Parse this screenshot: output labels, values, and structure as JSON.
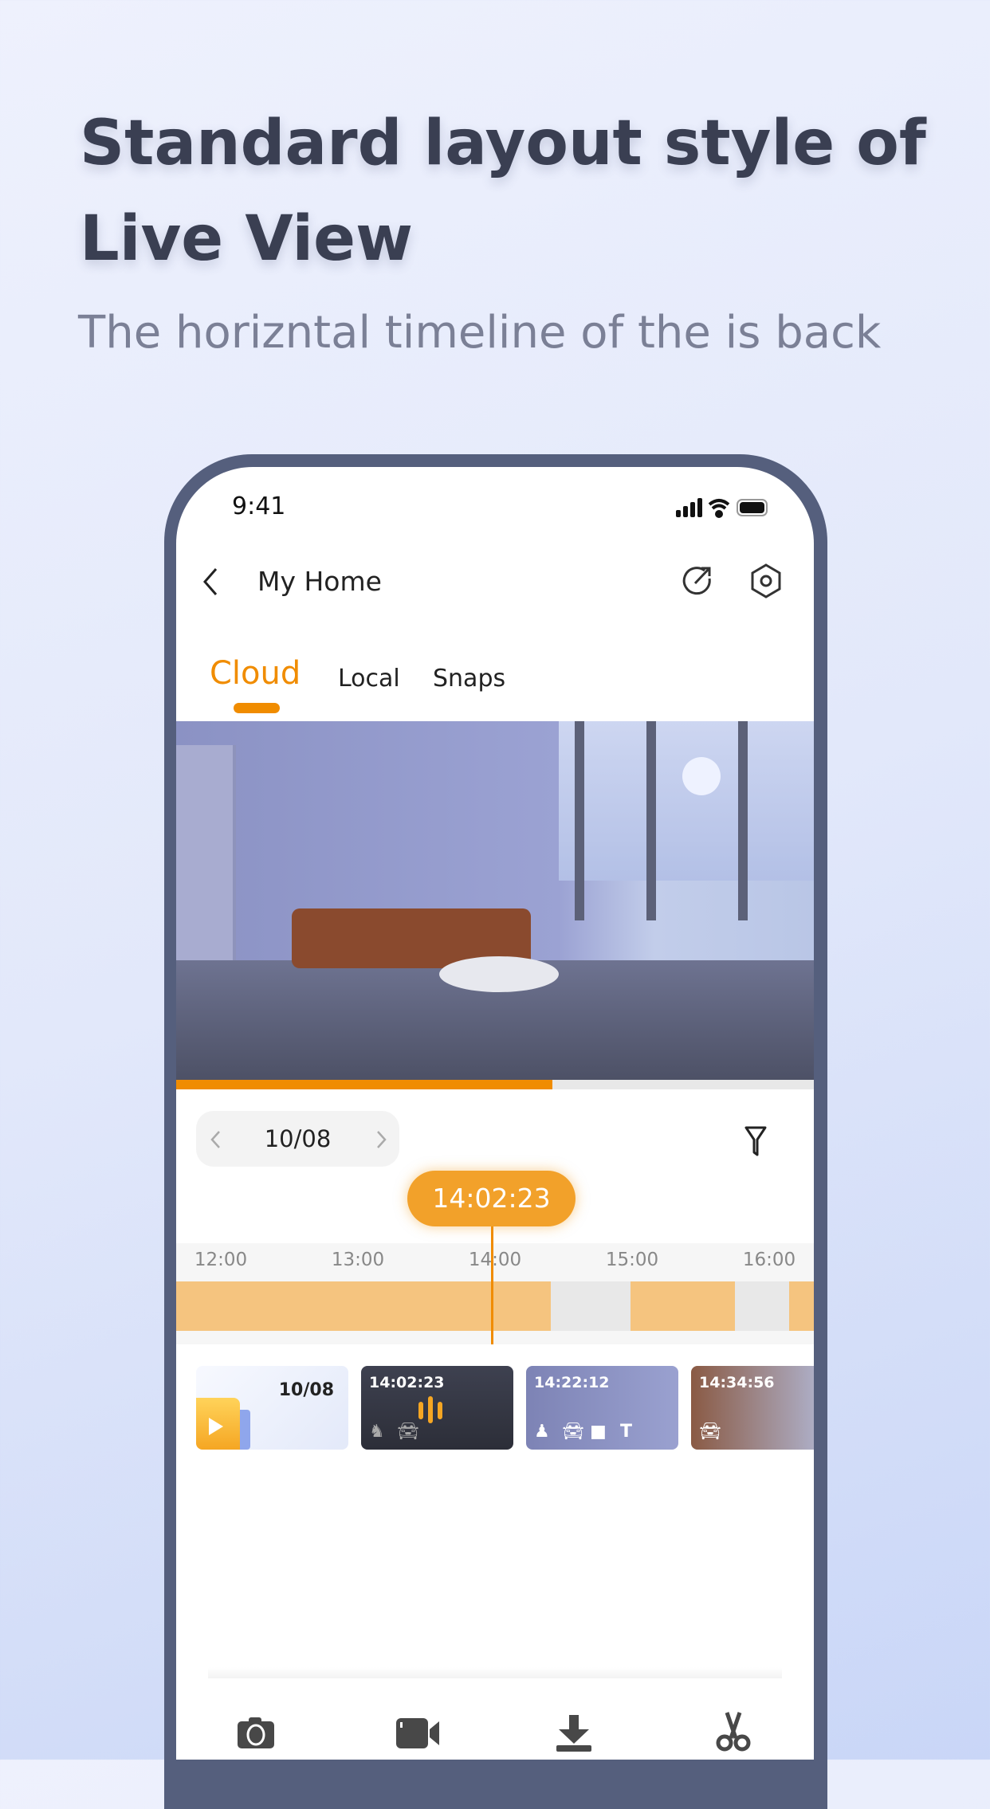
{
  "promo": {
    "headline_line1": "Standard layout style of",
    "headline_line2": "Live View",
    "subtitle": "The horizntal timeline of the is back"
  },
  "status_bar": {
    "time": "9:41",
    "icons": [
      "signal-icon",
      "wifi-icon",
      "battery-icon"
    ]
  },
  "nav": {
    "title": "My Home",
    "icons": [
      "back-icon",
      "share-icon",
      "settings-icon"
    ]
  },
  "tabs": [
    {
      "label": "Cloud",
      "active": true
    },
    {
      "label": "Local"
    },
    {
      "label": "Snaps"
    }
  ],
  "playback": {
    "progress_percent": 59
  },
  "date_picker": {
    "value": "10/08"
  },
  "timeline": {
    "current_time": "14:02:23",
    "ticks": [
      "12:00",
      "13:00",
      "14:00",
      "15:00",
      "16:00"
    ],
    "recorded_color": "#f5c47f",
    "empty_color": "#e8e8e8",
    "accent": "#f08c00"
  },
  "clips": [
    {
      "label": "10/08",
      "type": "day-summary"
    },
    {
      "time": "14:02:23",
      "events": [
        "pet-icon",
        "car-icon"
      ]
    },
    {
      "time": "14:22:12",
      "events": [
        "person-icon",
        "car-icon",
        "package-icon",
        "text-icon"
      ]
    },
    {
      "time": "14:34:56",
      "events": [
        "car-icon"
      ]
    }
  ],
  "toolbar": [
    "camera-icon",
    "video-record-icon",
    "download-icon",
    "scissors-icon"
  ]
}
